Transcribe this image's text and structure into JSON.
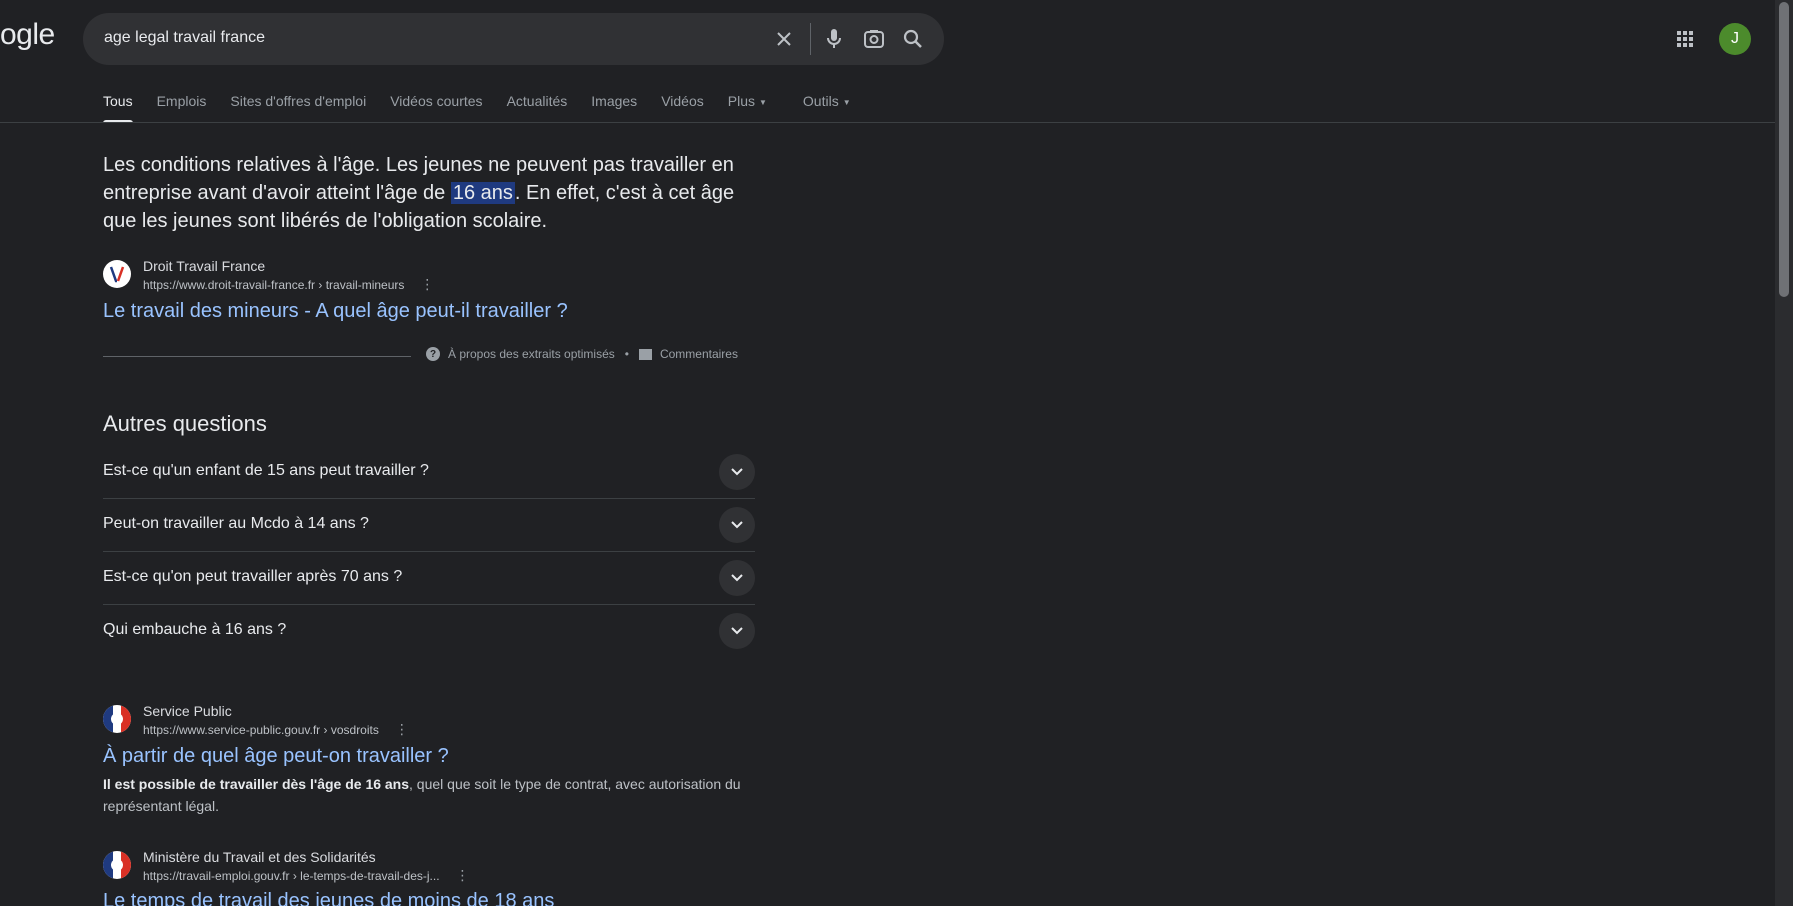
{
  "header": {
    "logo_text": "ogle",
    "search_value": "age legal travail france",
    "avatar_letter": "J"
  },
  "tabs": [
    {
      "label": "Tous",
      "active": true
    },
    {
      "label": "Emplois"
    },
    {
      "label": "Sites d'offres d'emploi"
    },
    {
      "label": "Vidéos courtes"
    },
    {
      "label": "Actualités"
    },
    {
      "label": "Images"
    },
    {
      "label": "Vidéos"
    },
    {
      "label": "Plus"
    },
    {
      "label": "Outils"
    }
  ],
  "snippet": {
    "text_before": "Les conditions relatives à l'âge. Les jeunes ne peuvent pas travailler en entreprise avant d'avoir atteint l'âge de ",
    "highlight": "16 ans",
    "text_after": ". En effet, c'est à cet âge que les jeunes sont libérés de l'obligation scolaire.",
    "source_name": "Droit Travail France",
    "source_url": "https://www.droit-travail-france.fr › travail-mineurs",
    "title": "Le travail des mineurs - A quel âge peut-il travailler ?",
    "about_label": "À propos des extraits optimisés",
    "separator": "•",
    "feedback_label": "Commentaires"
  },
  "paa": {
    "title": "Autres questions",
    "questions": [
      "Est-ce qu'un enfant de 15 ans peut travailler ?",
      "Peut-on travailler au Mcdo à 14 ans ?",
      "Est-ce qu'on peut travailler après 70 ans ?",
      "Qui embauche à 16 ans ?"
    ]
  },
  "results": [
    {
      "source_name": "Service Public",
      "source_url": "https://www.service-public.gouv.fr › vosdroits",
      "title": "À partir de quel âge peut-on travailler ?",
      "desc_bold": "Il est possible de travailler dès l'âge de 16 ans",
      "desc_rest": ", quel que soit le type de contrat, avec autorisation du représentant légal."
    },
    {
      "source_name": "Ministère du Travail et des Solidarités",
      "source_url": "https://travail-emploi.gouv.fr › le-temps-de-travail-des-j...",
      "title": "Le temps de travail des jeunes de moins de 18 ans"
    }
  ],
  "colors": {
    "background": "#202124",
    "link": "#99c3ff",
    "highlight": "#1f3a80",
    "avatar": "#4c8b2c"
  }
}
